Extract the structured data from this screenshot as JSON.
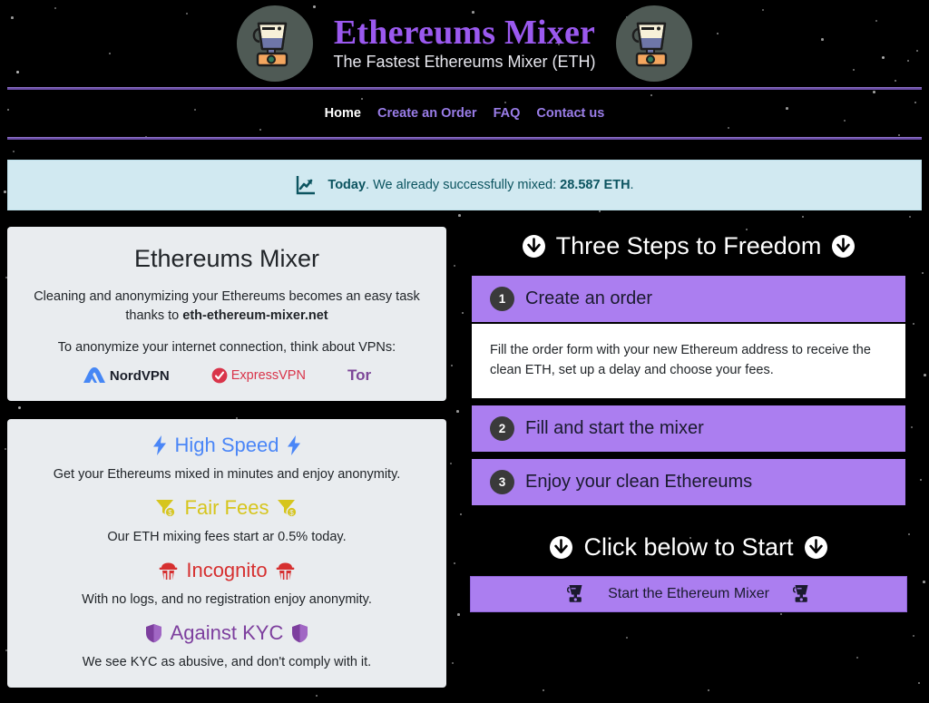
{
  "header": {
    "logo_icon": "blender-icon",
    "title": "Ethereums Mixer",
    "tagline": "The Fastest Ethereums Mixer (ETH)",
    "title_color": "#9b59ef"
  },
  "nav": {
    "items": [
      {
        "label": "Home",
        "active": true
      },
      {
        "label": "Create an Order",
        "active": false
      },
      {
        "label": "FAQ",
        "active": false
      },
      {
        "label": "Contact us",
        "active": false
      }
    ],
    "link_color": "#9a7de8",
    "active_color": "#ffffff"
  },
  "banner": {
    "icon": "chart-increasing-icon",
    "day_label": "Today",
    "separator": ".",
    "text": "We already successfully mixed:",
    "amount": "28.587 ETH",
    "period": ".",
    "bg_color": "#d1e9f1",
    "text_color": "#0c5460"
  },
  "intro_card": {
    "title": "Ethereums Mixer",
    "paragraph_1_before": "Cleaning and anonymizing your Ethereums becomes an easy task thanks to ",
    "paragraph_1_domain": "eth-ethereum-mixer.net",
    "paragraph_2": "To anonymize your internet connection, think about VPNs:",
    "vpns": [
      {
        "name": "NordVPN",
        "icon": "nordvpn-logo-icon",
        "color": "#1b1f2a",
        "mark_color": "#4687f5"
      },
      {
        "name": "ExpressVPN",
        "icon": "expressvpn-logo-icon",
        "color": "#d9344a",
        "mark_color": "#d9344a"
      },
      {
        "name": "Tor",
        "icon": "tor-logo-icon",
        "color": "#7d4698",
        "mark_color": "#7d4698"
      }
    ]
  },
  "features": [
    {
      "title": "High Speed",
      "icon": "lightning-bolt-icon",
      "color": "#4a86f7",
      "description": "Get your Ethereums mixed in minutes and enjoy anonymity."
    },
    {
      "title": "Fair Fees",
      "icon": "money-funnel-icon",
      "color": "#d6c51d",
      "description": "Our ETH mixing fees start ar 0.5% today."
    },
    {
      "title": "Incognito",
      "icon": "spy-detective-icon",
      "color": "#d63030",
      "description": "With no logs, and no registration enjoy anonymity."
    },
    {
      "title": "Against KYC",
      "icon": "shield-icon",
      "color": "#7d3f9e",
      "description": "We see KYC as abusive, and don't comply with it."
    }
  ],
  "steps_section": {
    "heading": "Three Steps to Freedom",
    "heading_icon": "arrow-down-circle-icon",
    "accent_color": "#ab7ef0",
    "items": [
      {
        "number": "1",
        "label": "Create an order",
        "body": "Fill the order form with your new Ethereum address to receive the clean ETH, set up a delay and choose your fees.",
        "expanded": true
      },
      {
        "number": "2",
        "label": "Fill and start the mixer",
        "body": "",
        "expanded": false
      },
      {
        "number": "3",
        "label": "Enjoy your clean Ethereums",
        "body": "",
        "expanded": false
      }
    ]
  },
  "cta_section": {
    "heading": "Click below to Start",
    "heading_icon": "arrow-down-circle-icon",
    "button_label": "Start the Ethereum Mixer",
    "button_icon": "blender-icon"
  }
}
